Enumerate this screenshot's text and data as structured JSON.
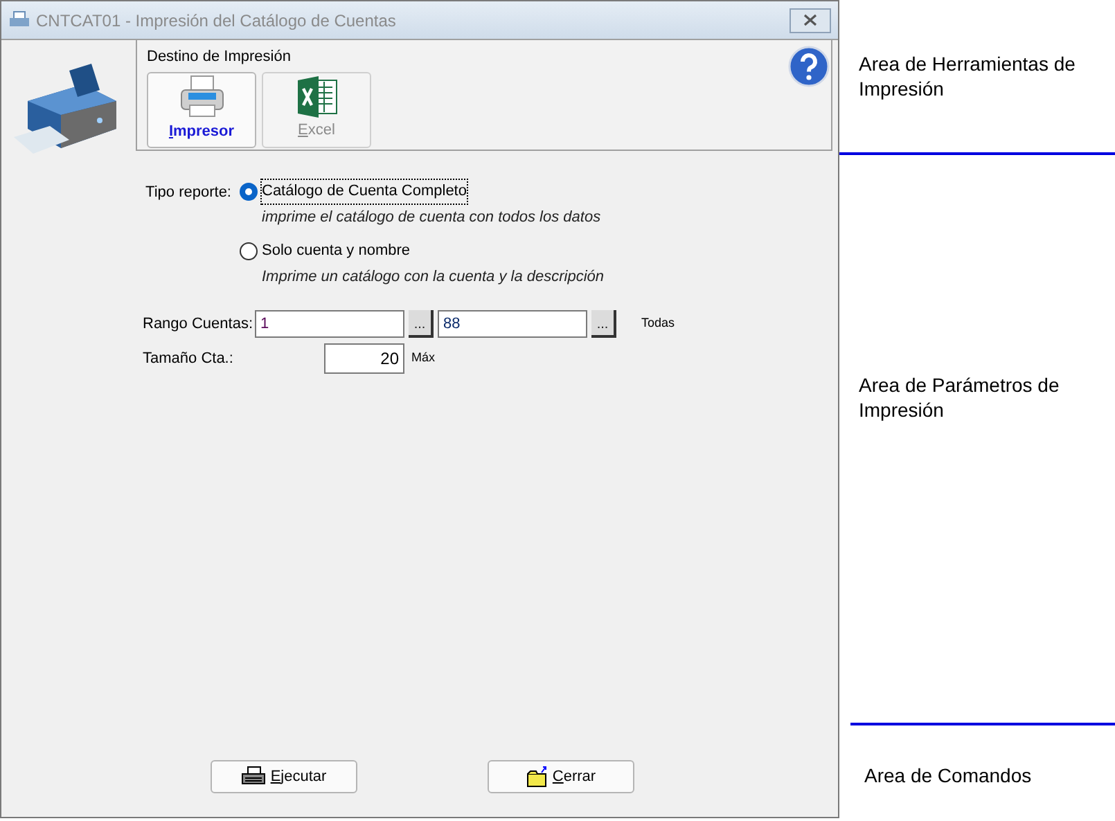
{
  "window": {
    "title": "CNTCAT01 - Impresión del Catálogo de Cuentas"
  },
  "toolbar": {
    "title": "Destino de Impresión",
    "destinations": [
      {
        "kind": "printer",
        "label": "Impresor",
        "selected": true,
        "disabled": false
      },
      {
        "kind": "excel",
        "label": "Excel",
        "selected": false,
        "disabled": true
      }
    ]
  },
  "report_type": {
    "label": "Tipo reporte:",
    "options": [
      {
        "label": "Catálogo de Cuenta Completo",
        "description": "imprime el catálogo de cuenta con todos los datos",
        "selected": true
      },
      {
        "label": "Solo cuenta y nombre",
        "description": "Imprime un catálogo con la cuenta y la descripción",
        "selected": false
      }
    ]
  },
  "range": {
    "label": "Rango Cuentas:",
    "from": "1",
    "to": "88",
    "browse": "...",
    "all": "Todas"
  },
  "size": {
    "label": "Tamaño Cta.:",
    "value": "20",
    "max": "Máx"
  },
  "commands": [
    {
      "kind": "run",
      "label": "Ejecutar"
    },
    {
      "kind": "close",
      "label": "Cerrar"
    }
  ],
  "annotations": [
    "Area de Herramientas de Impresión",
    "Area de Parámetros de Impresión",
    "Area de Comandos"
  ]
}
